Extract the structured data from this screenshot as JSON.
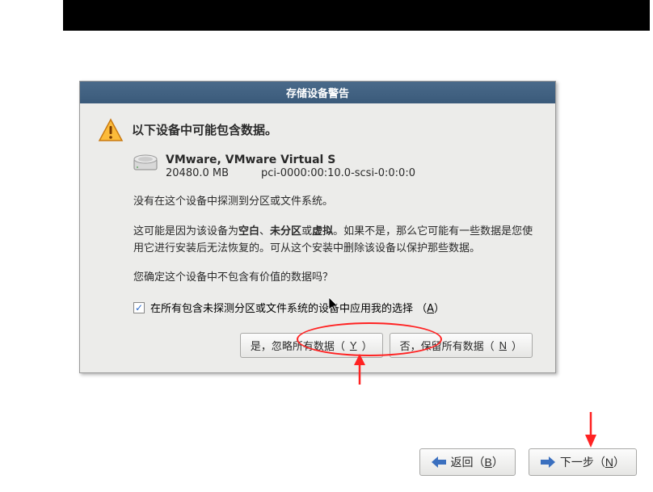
{
  "dialog": {
    "title": "存储设备警告",
    "heading": "以下设备中可能包含数据。",
    "device": {
      "name": "VMware, VMware Virtual S",
      "size": "20480.0 MB",
      "path": "pci-0000:00:10.0-scsi-0:0:0:0"
    },
    "line1": "没有在这个设备中探测到分区或文件系统。",
    "para2_pre": "这可能是因为该设备为",
    "para2_b1": "空白",
    "para2_sep1": "、",
    "para2_b2": "未分区",
    "para2_sep2": "或",
    "para2_b3": "虚拟",
    "para2_rest": "。如果不是，那么它可能有一些数据是您使用它进行安装后无法恢复的。可从这个安装中删除该设备以保护那些数据。",
    "confirm": "您确定这个设备中不包含有价值的数据吗？",
    "checkbox_label_pre": "在所有包含未探测分区或文件系统的设备中应用我的选择 （",
    "checkbox_hotkey": "A",
    "checkbox_label_post": "）",
    "btn_yes_pre": "是，忽略所有数据（",
    "btn_yes_hotkey": "Y",
    "btn_yes_post": "）",
    "btn_no_pre": "否，保留所有数据（",
    "btn_no_hotkey": "N",
    "btn_no_post": "）"
  },
  "nav": {
    "back_pre": "返回（",
    "back_hotkey": "B",
    "back_post": "）",
    "next_pre": "下一步（",
    "next_hotkey": "N",
    "next_post": "）"
  }
}
